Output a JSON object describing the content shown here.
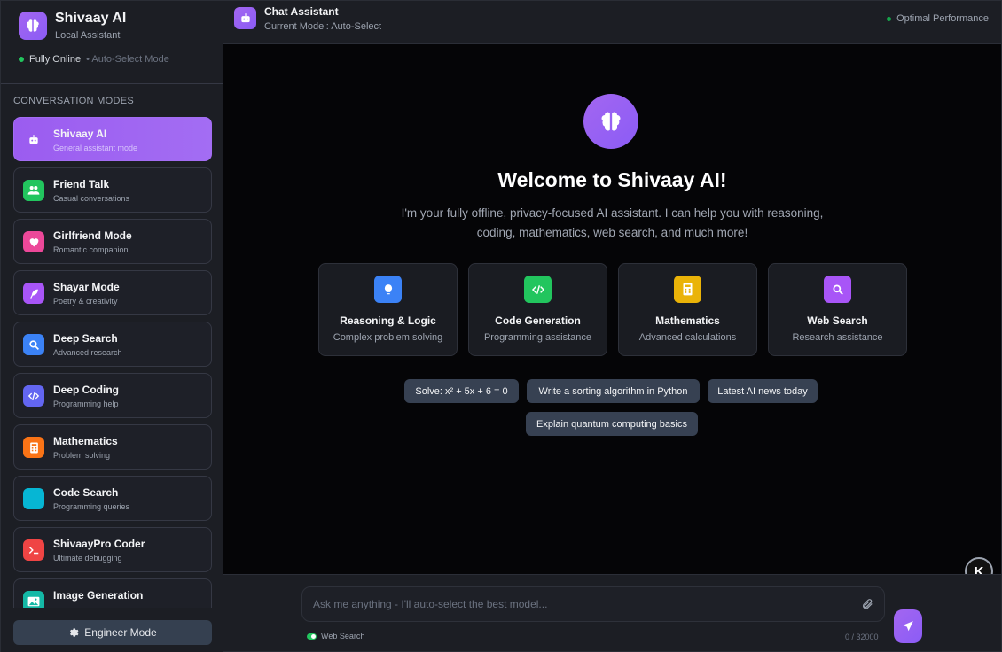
{
  "brand": {
    "name": "Shivaay AI",
    "subtitle": "Local Assistant",
    "status": "Fully Online",
    "mode": "• Auto-Select Mode"
  },
  "sidebar": {
    "section_title": "CONVERSATION MODES",
    "modes": [
      {
        "name": "Shivaay AI",
        "desc": "General assistant mode",
        "icon": "robot-icon",
        "color": "#9b5cf0"
      },
      {
        "name": "Friend Talk",
        "desc": "Casual conversations",
        "icon": "users-icon",
        "color": "#22c55e"
      },
      {
        "name": "Girlfriend Mode",
        "desc": "Romantic companion",
        "icon": "heart-icon",
        "color": "#ec4899"
      },
      {
        "name": "Shayar Mode",
        "desc": "Poetry & creativity",
        "icon": "feather-icon",
        "color": "#a855f7"
      },
      {
        "name": "Deep Search",
        "desc": "Advanced research",
        "icon": "search-icon",
        "color": "#3b82f6"
      },
      {
        "name": "Deep Coding",
        "desc": "Programming help",
        "icon": "code-icon",
        "color": "#6366f1"
      },
      {
        "name": "Mathematics",
        "desc": "Problem solving",
        "icon": "calculator-icon",
        "color": "#f97316"
      },
      {
        "name": "Code Search",
        "desc": "Programming queries",
        "icon": "code-search-icon",
        "color": "#06b6d4"
      },
      {
        "name": "ShivaayPro Coder",
        "desc": "Ultimate debugging",
        "icon": "terminal-icon",
        "color": "#ef4444"
      },
      {
        "name": "Image Generation",
        "desc": "",
        "icon": "image-icon",
        "color": "#14b8a6"
      }
    ],
    "engineer_button": "Engineer Mode"
  },
  "header": {
    "title": "Chat Assistant",
    "subtitle": "Current Model: Auto-Select",
    "performance": "Optimal Performance"
  },
  "welcome": {
    "title": "Welcome to Shivaay AI!",
    "intro_line1": "I'm your fully offline, privacy-focused AI assistant. I can help you with reasoning,",
    "intro_line2": "coding, mathematics, web search, and much more!"
  },
  "features": [
    {
      "title": "Reasoning & Logic",
      "desc": "Complex problem solving",
      "icon": "lightbulb-icon",
      "color": "#3b82f6"
    },
    {
      "title": "Code Generation",
      "desc": "Programming assistance",
      "icon": "code-icon",
      "color": "#22c55e"
    },
    {
      "title": "Mathematics",
      "desc": "Advanced calculations",
      "icon": "calculator-icon",
      "color": "#eab308"
    },
    {
      "title": "Web Search",
      "desc": "Research assistance",
      "icon": "search-icon",
      "color": "#a855f7"
    }
  ],
  "suggestions": [
    "Solve: x² + 5x + 6 = 0",
    "Write a sorting algorithm in Python",
    "Latest AI news today",
    "Explain quantum computing basics"
  ],
  "composer": {
    "placeholder": "Ask me anything - I'll auto-select the best model...",
    "value": "",
    "web_search_label": "Web Search",
    "web_search_on": true,
    "counter": "0 / 32000"
  },
  "corner_badge": "K"
}
